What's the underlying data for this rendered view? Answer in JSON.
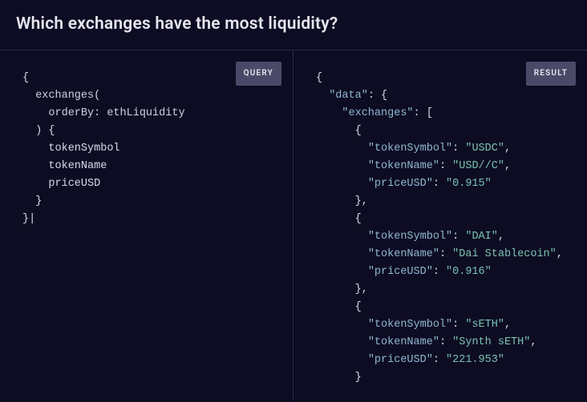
{
  "title": "Which exchanges have the most liquidity?",
  "labels": {
    "query": "QUERY",
    "result": "RESULT"
  },
  "query": {
    "root": "exchanges",
    "arg_key": "orderBy",
    "arg_val": "ethLiquidity",
    "fields": [
      "tokenSymbol",
      "tokenName",
      "priceUSD"
    ]
  },
  "result": {
    "root_key": "data",
    "list_key": "exchanges",
    "field_keys": [
      "tokenSymbol",
      "tokenName",
      "priceUSD"
    ],
    "rows": [
      {
        "tokenSymbol": "USDC",
        "tokenName": "USD//C",
        "priceUSD": "0.915"
      },
      {
        "tokenSymbol": "DAI",
        "tokenName": "Dai Stablecoin",
        "priceUSD": "0.916"
      },
      {
        "tokenSymbol": "sETH",
        "tokenName": "Synth sETH",
        "priceUSD": "221.953"
      }
    ]
  }
}
